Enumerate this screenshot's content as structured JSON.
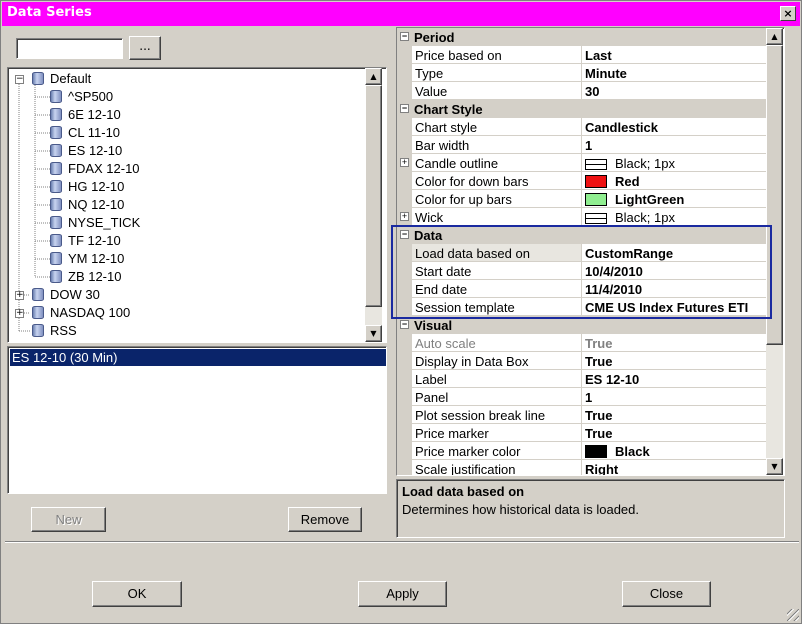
{
  "window": {
    "title": "Data Series",
    "close_glyph": "×"
  },
  "search": {
    "value": "",
    "browse_label": "..."
  },
  "tree": {
    "items": [
      {
        "label": "Default",
        "expander": "−",
        "level": 0
      },
      {
        "label": "^SP500",
        "level": 1
      },
      {
        "label": "6E 12-10",
        "level": 1
      },
      {
        "label": "CL 11-10",
        "level": 1
      },
      {
        "label": "ES 12-10",
        "level": 1
      },
      {
        "label": "FDAX 12-10",
        "level": 1
      },
      {
        "label": "HG 12-10",
        "level": 1
      },
      {
        "label": "NQ 12-10",
        "level": 1
      },
      {
        "label": "NYSE_TICK",
        "level": 1
      },
      {
        "label": "TF 12-10",
        "level": 1
      },
      {
        "label": "YM 12-10",
        "level": 1
      },
      {
        "label": "ZB 12-10",
        "level": 1
      },
      {
        "label": "DOW 30",
        "expander": "+",
        "level": 0
      },
      {
        "label": "NASDAQ 100",
        "expander": "+",
        "level": 0
      },
      {
        "label": "RSS",
        "level": 0
      }
    ]
  },
  "series_list": {
    "selected": "ES 12-10 (30 Min)"
  },
  "buttons": {
    "new": "New",
    "remove": "Remove",
    "ok": "OK",
    "apply": "Apply",
    "close": "Close"
  },
  "properties": {
    "period": {
      "title": "Period",
      "rows": [
        {
          "name": "Price based on",
          "value": "Last"
        },
        {
          "name": "Type",
          "value": "Minute"
        },
        {
          "name": "Value",
          "value": "30"
        }
      ]
    },
    "chart_style": {
      "title": "Chart Style",
      "rows": [
        {
          "name": "Chart style",
          "value": "Candlestick"
        },
        {
          "name": "Bar width",
          "value": "1"
        },
        {
          "name": "Candle outline",
          "value": "Black; 1px"
        },
        {
          "name": "Color for down bars",
          "value": "Red"
        },
        {
          "name": "Color for up bars",
          "value": "LightGreen"
        },
        {
          "name": "Wick",
          "value": "Black; 1px"
        }
      ]
    },
    "data": {
      "title": "Data",
      "rows": [
        {
          "name": "Load data based on",
          "value": "CustomRange"
        },
        {
          "name": "Start date",
          "value": "10/4/2010"
        },
        {
          "name": "End date",
          "value": "11/4/2010"
        },
        {
          "name": "Session template",
          "value": "CME US Index Futures ETI"
        }
      ]
    },
    "visual": {
      "title": "Visual",
      "rows": [
        {
          "name": "Auto scale",
          "value": "True"
        },
        {
          "name": "Display in Data Box",
          "value": "True"
        },
        {
          "name": "Label",
          "value": "ES 12-10"
        },
        {
          "name": "Panel",
          "value": "1"
        },
        {
          "name": "Plot session break line",
          "value": "True"
        },
        {
          "name": "Price marker",
          "value": "True"
        },
        {
          "name": "Price marker color",
          "value": "Black"
        },
        {
          "name": "Scale justification",
          "value": "Right"
        }
      ]
    }
  },
  "description": {
    "title": "Load data based on",
    "text": "Determines how historical data is loaded."
  },
  "colors": {
    "titlebar": "#ff00ff",
    "selection": "#0a246a",
    "down_bars": "#ee1111",
    "up_bars": "#90ee90",
    "marker": "#000000"
  }
}
